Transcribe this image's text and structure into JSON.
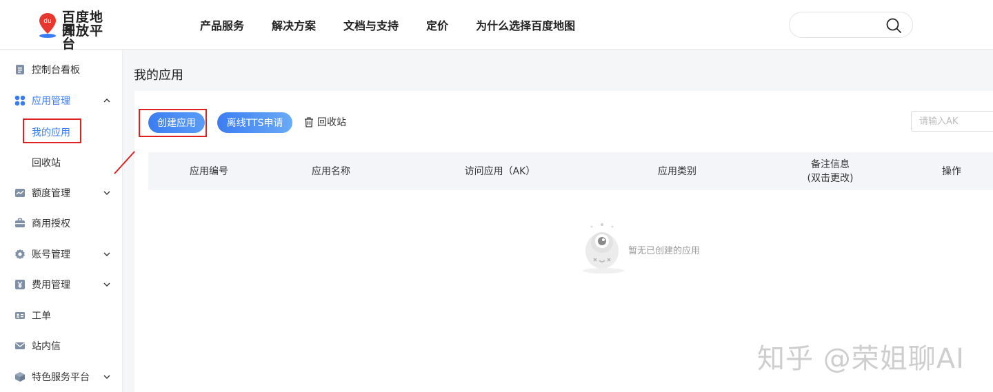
{
  "header": {
    "logo": {
      "line1": "百度地图",
      "line2": "开放平台",
      "badge": "du"
    },
    "nav": [
      "产品服务",
      "解决方案",
      "文档与支持",
      "定价",
      "为什么选择百度地图"
    ],
    "search": {
      "placeholder": "",
      "icon": "search-icon"
    }
  },
  "sidebar": {
    "items": [
      {
        "label": "控制台看板",
        "icon": "document-icon"
      },
      {
        "label": "应用管理",
        "icon": "grid-icon",
        "expanded": true
      },
      {
        "label": "额度管理",
        "icon": "chart-icon"
      },
      {
        "label": "商用授权",
        "icon": "briefcase-icon"
      },
      {
        "label": "账号管理",
        "icon": "gear-icon"
      },
      {
        "label": "费用管理",
        "icon": "yen-icon"
      },
      {
        "label": "工单",
        "icon": "id-card-icon"
      },
      {
        "label": "站内信",
        "icon": "mail-icon"
      },
      {
        "label": "特色服务平台",
        "icon": "cube-icon"
      }
    ],
    "sub_items": [
      {
        "label": "我的应用",
        "active": true
      },
      {
        "label": "回收站",
        "active": false
      }
    ]
  },
  "main": {
    "title": "我的应用",
    "toolbar": {
      "create_label": "创建应用",
      "tts_label": "离线TTS申请",
      "recycle_label": "回收站",
      "ak_placeholder": "请输入AK"
    },
    "table": {
      "columns": [
        "应用编号",
        "应用名称",
        "访问应用（AK）",
        "应用类别",
        "备注信息",
        "(双击更改)",
        "操作"
      ]
    },
    "empty_text": "暂无已创建的应用"
  },
  "watermark": "知乎 @荣姐聊AI",
  "colors": {
    "accent": "#3a7cf2",
    "annotation": "#e02020"
  }
}
